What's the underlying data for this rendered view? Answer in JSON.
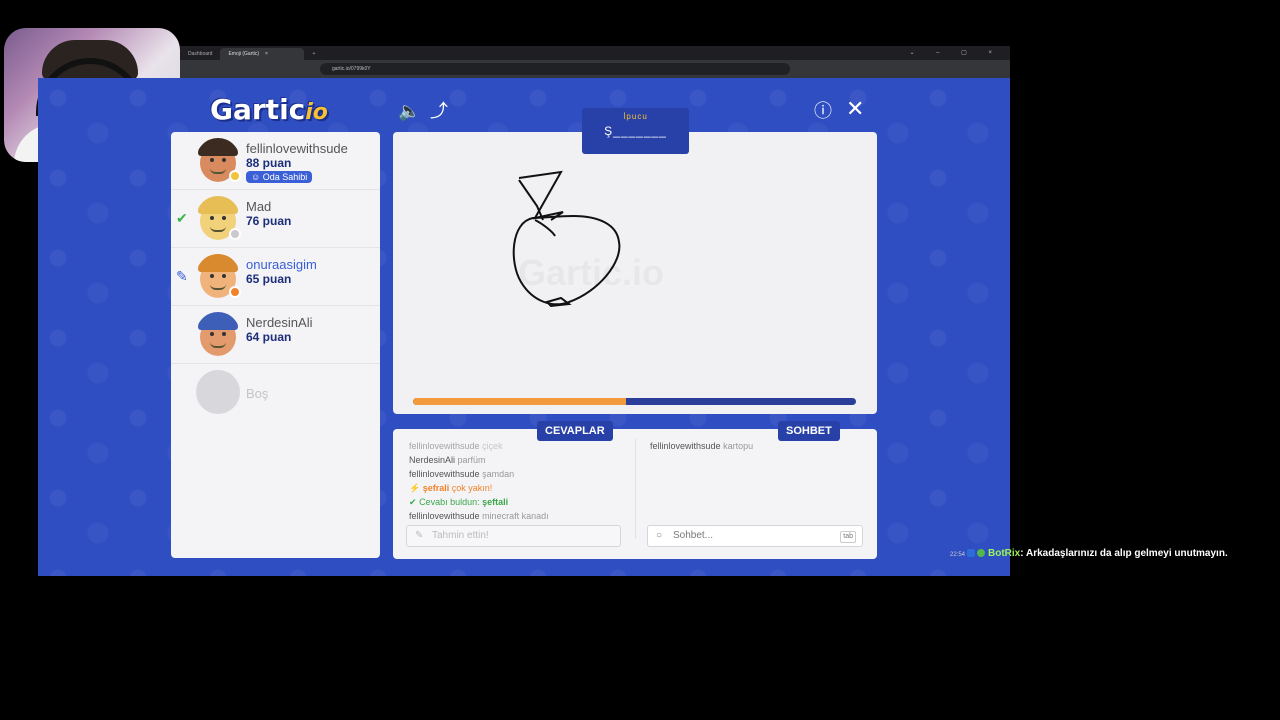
{
  "browser": {
    "tabs": [
      {
        "label": "Dashboard"
      },
      {
        "label": "Emoji (Gartic)"
      }
    ],
    "url": "gartic.io/0799k0Y"
  },
  "game": {
    "logo": "Gartic",
    "logo_suffix": "io",
    "players": [
      {
        "name": "fellinlovewithsude",
        "points": "88 puan",
        "badge": "Oda Sahibi",
        "status_color": "#f2c33b",
        "skin": "#d98b5f",
        "hair": "#3b2b20"
      },
      {
        "name": "Mad",
        "points": "76 puan",
        "mark": "✔",
        "mark_color": "#38b54a",
        "status_color": "#c9c9ce",
        "skin": "#f1d27a",
        "hair": "#e7be55"
      },
      {
        "name": "onuraasigim",
        "points": "65 puan",
        "mark": "✎",
        "mark_color": "#3a5fd6",
        "status_color": "#f1822a",
        "skin": "#f1b37c",
        "hair": "#d9892e"
      },
      {
        "name": "NerdesinAli",
        "points": "64 puan",
        "skin": "#e39a6c",
        "hair": "#3e5fb8"
      },
      {
        "name": "Boş",
        "empty": true
      }
    ],
    "hint": {
      "title": "İpucu",
      "word": "Ş_______"
    },
    "progress": 0.48,
    "tabs": {
      "answers": "CEVAPLAR",
      "chat": "SOHBET"
    },
    "answers": [
      {
        "user": "fellinlovewithsude",
        "text": "çiçek"
      },
      {
        "user": "NerdesinAli",
        "text": "parfüm"
      },
      {
        "user": "fellinlovewithsude",
        "text": "şamdan"
      },
      {
        "type": "close",
        "user": "şefrali",
        "text": "çok yakın!"
      },
      {
        "type": "found",
        "user": "Cevabı buldun:",
        "text": "şeftali"
      },
      {
        "user": "fellinlovewithsude",
        "text": "minecraft kanadı"
      }
    ],
    "answer_placeholder": "Tahmin ettin!",
    "chat_messages": [
      {
        "user": "fellinlovewithsude",
        "text": "kartopu"
      }
    ],
    "chat_placeholder": "Sohbet...",
    "tab_key": "tab"
  },
  "stream_chat": {
    "time": "22:54",
    "user": "BotRix",
    "message": ": Arkadaşlarınızı da alıp gelmeyi unutmayın."
  },
  "colors": {
    "game_bg": "#2f4ec2",
    "panel": "#f4f4f6",
    "accent": "#2841a8",
    "progress": "#f29a3c"
  }
}
